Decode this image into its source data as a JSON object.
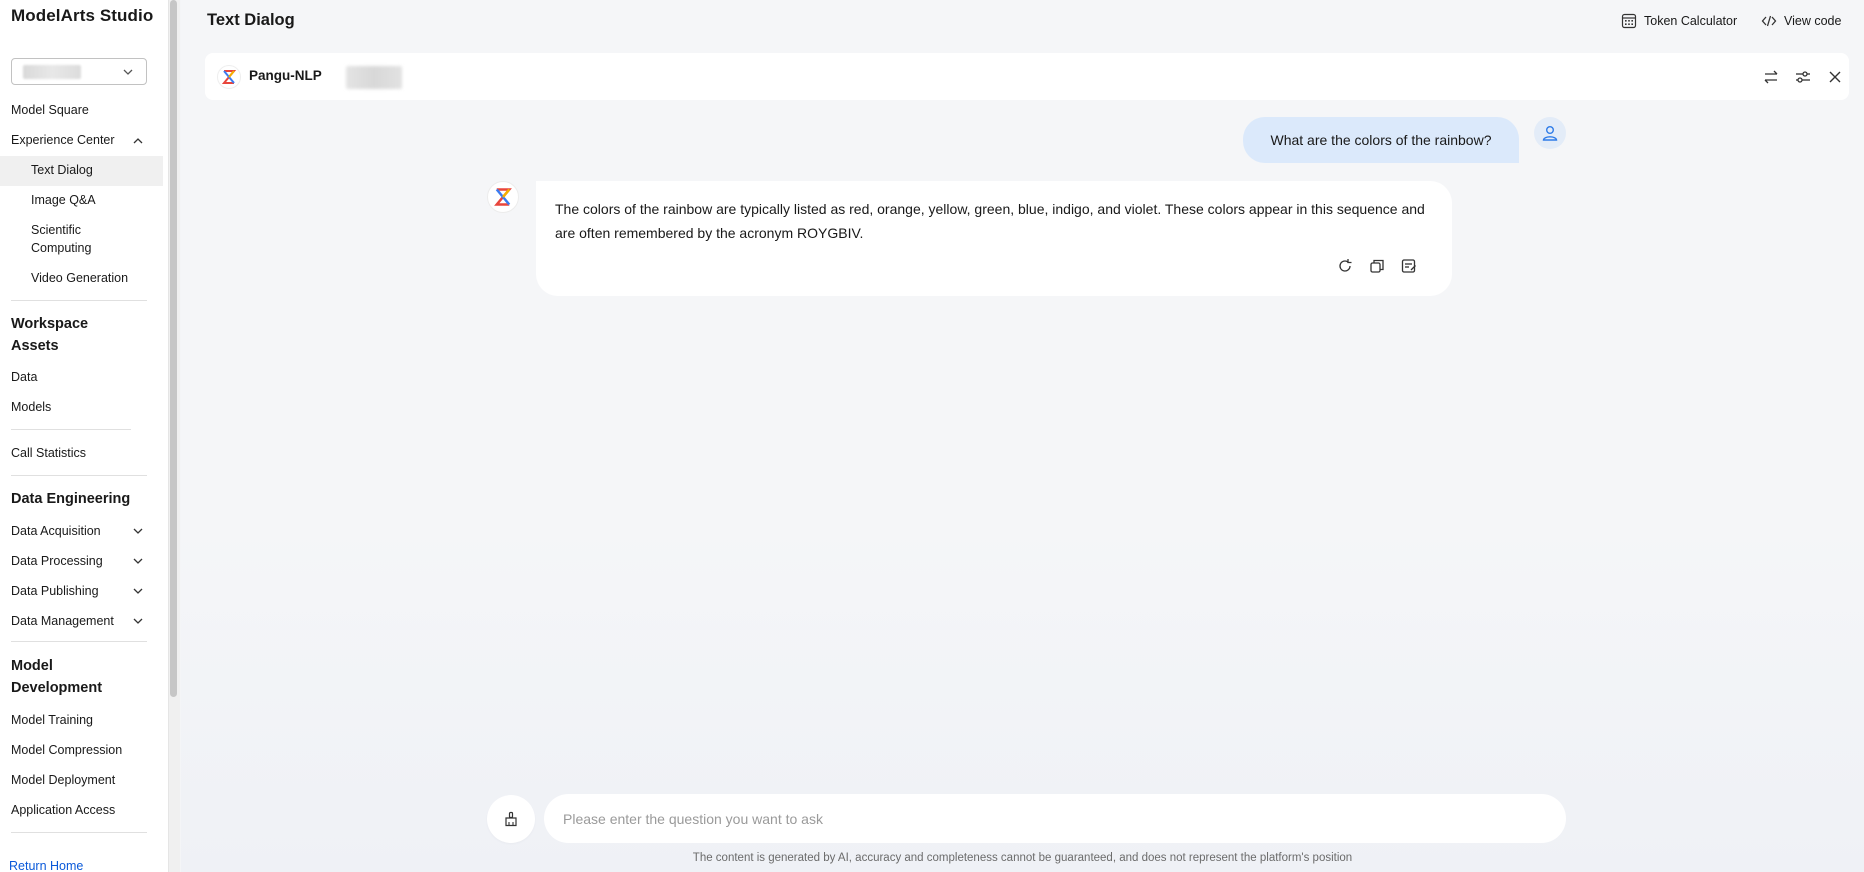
{
  "sidebar": {
    "brand": "ModelArts Studio",
    "region_select": {
      "value": ""
    },
    "items": {
      "model_square": "Model Square",
      "experience_center": "Experience Center",
      "text_dialog": "Text Dialog",
      "image_qa": "Image Q&A",
      "scientific_computing_1": "Scientific",
      "scientific_computing_2": "Computing",
      "video_generation": "Video Generation",
      "workspace_assets_1": "Workspace",
      "workspace_assets_2": "Assets",
      "data": "Data",
      "models": "Models",
      "call_statistics": "Call Statistics",
      "data_engineering": "Data Engineering",
      "data_acquisition": "Data Acquisition",
      "data_processing": "Data Processing",
      "data_publishing": "Data Publishing",
      "data_management": "Data Management",
      "model_development_1": "Model",
      "model_development_2": "Development",
      "model_training": "Model Training",
      "model_compression": "Model Compression",
      "model_deployment": "Model Deployment",
      "application_access": "Application Access",
      "return_home": "Return Home"
    }
  },
  "header": {
    "title": "Text Dialog",
    "token_calculator": "Token Calculator",
    "view_code": "View code"
  },
  "model_bar": {
    "name": "Pangu-NLP"
  },
  "conversation": {
    "user_message": "What are the colors of the rainbow?",
    "bot_message_line1": "The colors of the rainbow are typically listed as red, orange, yellow, green, blue, indigo, and violet. These colors appear in this sequence and",
    "bot_message_line2": "are often remembered by the acronym ROYGBIV."
  },
  "input": {
    "placeholder": "Please enter the question you want to ask",
    "value": ""
  },
  "footer": {
    "disclaimer": "The content is generated by AI, accuracy and completeness cannot be guaranteed, and does not represent the platform's position"
  },
  "colors": {
    "accent": "#0a59d9",
    "user_bubble": "#dbe9fb",
    "active_item_bg": "#f0f0f0"
  },
  "icons": {
    "chevron_down": "chevron-down-icon",
    "chevron_up": "chevron-up-icon",
    "token_calculator": "calculator-icon",
    "view_code": "code-icon",
    "switch_model": "switch-icon",
    "settings": "sliders-icon",
    "close": "close-icon",
    "regenerate": "refresh-icon",
    "copy": "copy-icon",
    "feedback": "note-icon",
    "clear": "broom-icon",
    "user": "user-icon",
    "bot": "pangu-logo-icon"
  }
}
